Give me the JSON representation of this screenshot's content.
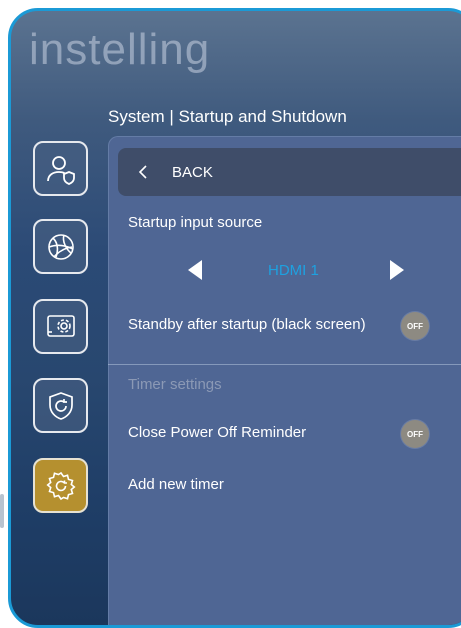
{
  "background_heading": "instelling",
  "breadcrumb": "System | Startup and Shutdown",
  "sidebar": {
    "items": [
      {
        "icon": "user-shield-icon"
      },
      {
        "icon": "globe-network-icon"
      },
      {
        "icon": "display-settings-icon"
      },
      {
        "icon": "shield-restore-icon"
      },
      {
        "icon": "gear-refresh-icon",
        "active": true
      }
    ]
  },
  "panel": {
    "back_label": "BACK",
    "startup_input_label": "Startup input source",
    "startup_input_value": "HDMI 1",
    "standby_label": "Standby after startup (black screen)",
    "standby_toggle": "OFF",
    "timer_section_label": "Timer settings",
    "power_off_reminder_label": "Close Power Off Reminder",
    "power_off_reminder_toggle": "OFF",
    "add_timer_label": "Add new timer"
  },
  "colors": {
    "frame": "#1b9ad6",
    "panel": "#4f6694",
    "accent_value": "#1ea1e0",
    "active_sidebar": "#b5902f"
  }
}
